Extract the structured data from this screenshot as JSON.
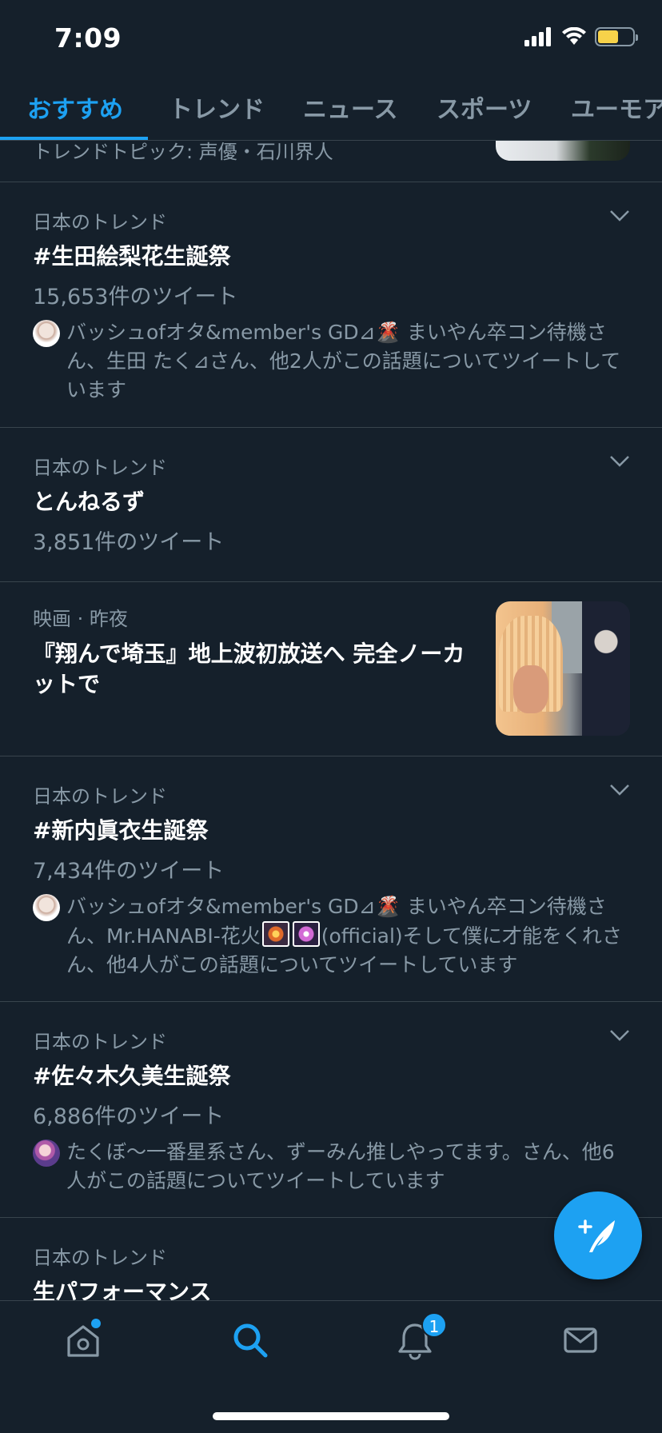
{
  "status_bar": {
    "time": "7:09",
    "battery_color": "#f7d24a"
  },
  "tabs": [
    {
      "label": "おすすめ",
      "active": true
    },
    {
      "label": "トレンド"
    },
    {
      "label": "ニュース"
    },
    {
      "label": "スポーツ"
    },
    {
      "label": "ユーモア"
    }
  ],
  "cut_item": {
    "text": "トレンドトピック: 声優・石川界人"
  },
  "trends": [
    {
      "meta": "日本のトレンド",
      "title": "#生田絵梨花生誕祭",
      "count": "15,653件のツイート",
      "who": "バッシュofオタ&member's GD⊿🌋 まいやん卒コン待機さん、生田 たく⊿さん、他2人がこの話題についてツイートしています"
    },
    {
      "meta": "日本のトレンド",
      "title": "とんねるず",
      "count": "3,851件のツイート"
    }
  ],
  "news": {
    "meta": "映画 · 昨夜",
    "title": "『翔んで埼玉』地上波初放送へ 完全ノーカットで"
  },
  "trends2": [
    {
      "meta": "日本のトレンド",
      "title": "#新内眞衣生誕祭",
      "count": "7,434件のツイート",
      "who_a": "バッシュofオタ&member's GD⊿🌋 まいやん卒コン待機さん、Mr.HANABI-花火",
      "who_b": "(official)そして僕に才能をくれさん、他4人がこの話題についてツイートしています"
    },
    {
      "meta": "日本のトレンド",
      "title": "#佐々木久美生誕祭",
      "count": "6,886件のツイート",
      "who": "たくぼ〜一番星系さん、ずーみん推しやってます。さん、他6人がこの話題についてツイートしています"
    }
  ],
  "partial": {
    "meta": "日本のトレンド",
    "title": "生パフォーマンス"
  },
  "bottom_nav": {
    "notifications_badge": "1"
  },
  "colors": {
    "accent": "#1da1f2",
    "background": "#15202b",
    "muted": "#8899a6",
    "divider": "#38444d"
  }
}
